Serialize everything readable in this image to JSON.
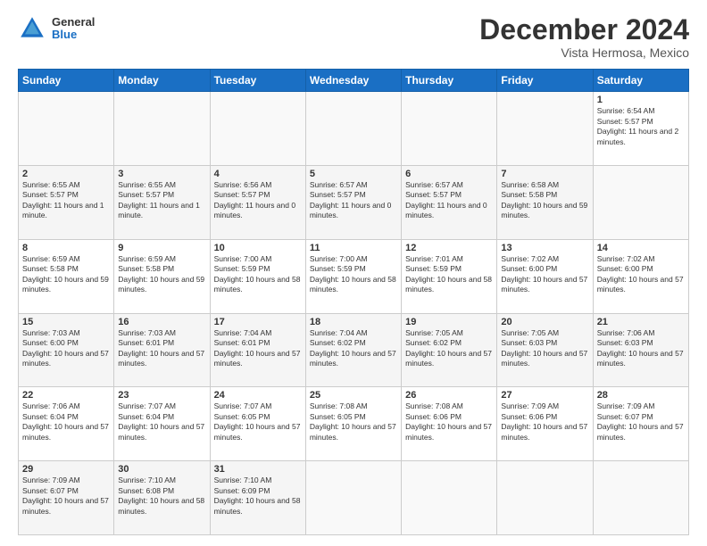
{
  "header": {
    "logo": {
      "general": "General",
      "blue": "Blue"
    },
    "title": "December 2024",
    "subtitle": "Vista Hermosa, Mexico"
  },
  "calendar": {
    "days_of_week": [
      "Sunday",
      "Monday",
      "Tuesday",
      "Wednesday",
      "Thursday",
      "Friday",
      "Saturday"
    ],
    "weeks": [
      [
        null,
        null,
        null,
        null,
        null,
        null,
        {
          "day": "1",
          "sunrise": "Sunrise: 6:54 AM",
          "sunset": "Sunset: 5:57 PM",
          "daylight": "Daylight: 11 hours and 2 minutes."
        }
      ],
      [
        {
          "day": "2",
          "sunrise": "Sunrise: 6:55 AM",
          "sunset": "Sunset: 5:57 PM",
          "daylight": "Daylight: 11 hours and 1 minute."
        },
        {
          "day": "3",
          "sunrise": "Sunrise: 6:55 AM",
          "sunset": "Sunset: 5:57 PM",
          "daylight": "Daylight: 11 hours and 1 minute."
        },
        {
          "day": "4",
          "sunrise": "Sunrise: 6:56 AM",
          "sunset": "Sunset: 5:57 PM",
          "daylight": "Daylight: 11 hours and 0 minutes."
        },
        {
          "day": "5",
          "sunrise": "Sunrise: 6:57 AM",
          "sunset": "Sunset: 5:57 PM",
          "daylight": "Daylight: 11 hours and 0 minutes."
        },
        {
          "day": "6",
          "sunrise": "Sunrise: 6:57 AM",
          "sunset": "Sunset: 5:57 PM",
          "daylight": "Daylight: 11 hours and 0 minutes."
        },
        {
          "day": "7",
          "sunrise": "Sunrise: 6:58 AM",
          "sunset": "Sunset: 5:58 PM",
          "daylight": "Daylight: 10 hours and 59 minutes."
        }
      ],
      [
        {
          "day": "8",
          "sunrise": "Sunrise: 6:59 AM",
          "sunset": "Sunset: 5:58 PM",
          "daylight": "Daylight: 10 hours and 59 minutes."
        },
        {
          "day": "9",
          "sunrise": "Sunrise: 6:59 AM",
          "sunset": "Sunset: 5:58 PM",
          "daylight": "Daylight: 10 hours and 59 minutes."
        },
        {
          "day": "10",
          "sunrise": "Sunrise: 7:00 AM",
          "sunset": "Sunset: 5:59 PM",
          "daylight": "Daylight: 10 hours and 58 minutes."
        },
        {
          "day": "11",
          "sunrise": "Sunrise: 7:00 AM",
          "sunset": "Sunset: 5:59 PM",
          "daylight": "Daylight: 10 hours and 58 minutes."
        },
        {
          "day": "12",
          "sunrise": "Sunrise: 7:01 AM",
          "sunset": "Sunset: 5:59 PM",
          "daylight": "Daylight: 10 hours and 58 minutes."
        },
        {
          "day": "13",
          "sunrise": "Sunrise: 7:02 AM",
          "sunset": "Sunset: 6:00 PM",
          "daylight": "Daylight: 10 hours and 57 minutes."
        },
        {
          "day": "14",
          "sunrise": "Sunrise: 7:02 AM",
          "sunset": "Sunset: 6:00 PM",
          "daylight": "Daylight: 10 hours and 57 minutes."
        }
      ],
      [
        {
          "day": "15",
          "sunrise": "Sunrise: 7:03 AM",
          "sunset": "Sunset: 6:00 PM",
          "daylight": "Daylight: 10 hours and 57 minutes."
        },
        {
          "day": "16",
          "sunrise": "Sunrise: 7:03 AM",
          "sunset": "Sunset: 6:01 PM",
          "daylight": "Daylight: 10 hours and 57 minutes."
        },
        {
          "day": "17",
          "sunrise": "Sunrise: 7:04 AM",
          "sunset": "Sunset: 6:01 PM",
          "daylight": "Daylight: 10 hours and 57 minutes."
        },
        {
          "day": "18",
          "sunrise": "Sunrise: 7:04 AM",
          "sunset": "Sunset: 6:02 PM",
          "daylight": "Daylight: 10 hours and 57 minutes."
        },
        {
          "day": "19",
          "sunrise": "Sunrise: 7:05 AM",
          "sunset": "Sunset: 6:02 PM",
          "daylight": "Daylight: 10 hours and 57 minutes."
        },
        {
          "day": "20",
          "sunrise": "Sunrise: 7:05 AM",
          "sunset": "Sunset: 6:03 PM",
          "daylight": "Daylight: 10 hours and 57 minutes."
        },
        {
          "day": "21",
          "sunrise": "Sunrise: 7:06 AM",
          "sunset": "Sunset: 6:03 PM",
          "daylight": "Daylight: 10 hours and 57 minutes."
        }
      ],
      [
        {
          "day": "22",
          "sunrise": "Sunrise: 7:06 AM",
          "sunset": "Sunset: 6:04 PM",
          "daylight": "Daylight: 10 hours and 57 minutes."
        },
        {
          "day": "23",
          "sunrise": "Sunrise: 7:07 AM",
          "sunset": "Sunset: 6:04 PM",
          "daylight": "Daylight: 10 hours and 57 minutes."
        },
        {
          "day": "24",
          "sunrise": "Sunrise: 7:07 AM",
          "sunset": "Sunset: 6:05 PM",
          "daylight": "Daylight: 10 hours and 57 minutes."
        },
        {
          "day": "25",
          "sunrise": "Sunrise: 7:08 AM",
          "sunset": "Sunset: 6:05 PM",
          "daylight": "Daylight: 10 hours and 57 minutes."
        },
        {
          "day": "26",
          "sunrise": "Sunrise: 7:08 AM",
          "sunset": "Sunset: 6:06 PM",
          "daylight": "Daylight: 10 hours and 57 minutes."
        },
        {
          "day": "27",
          "sunrise": "Sunrise: 7:09 AM",
          "sunset": "Sunset: 6:06 PM",
          "daylight": "Daylight: 10 hours and 57 minutes."
        },
        {
          "day": "28",
          "sunrise": "Sunrise: 7:09 AM",
          "sunset": "Sunset: 6:07 PM",
          "daylight": "Daylight: 10 hours and 57 minutes."
        }
      ],
      [
        {
          "day": "29",
          "sunrise": "Sunrise: 7:09 AM",
          "sunset": "Sunset: 6:07 PM",
          "daylight": "Daylight: 10 hours and 57 minutes."
        },
        {
          "day": "30",
          "sunrise": "Sunrise: 7:10 AM",
          "sunset": "Sunset: 6:08 PM",
          "daylight": "Daylight: 10 hours and 58 minutes."
        },
        {
          "day": "31",
          "sunrise": "Sunrise: 7:10 AM",
          "sunset": "Sunset: 6:09 PM",
          "daylight": "Daylight: 10 hours and 58 minutes."
        },
        null,
        null,
        null,
        null
      ]
    ]
  }
}
